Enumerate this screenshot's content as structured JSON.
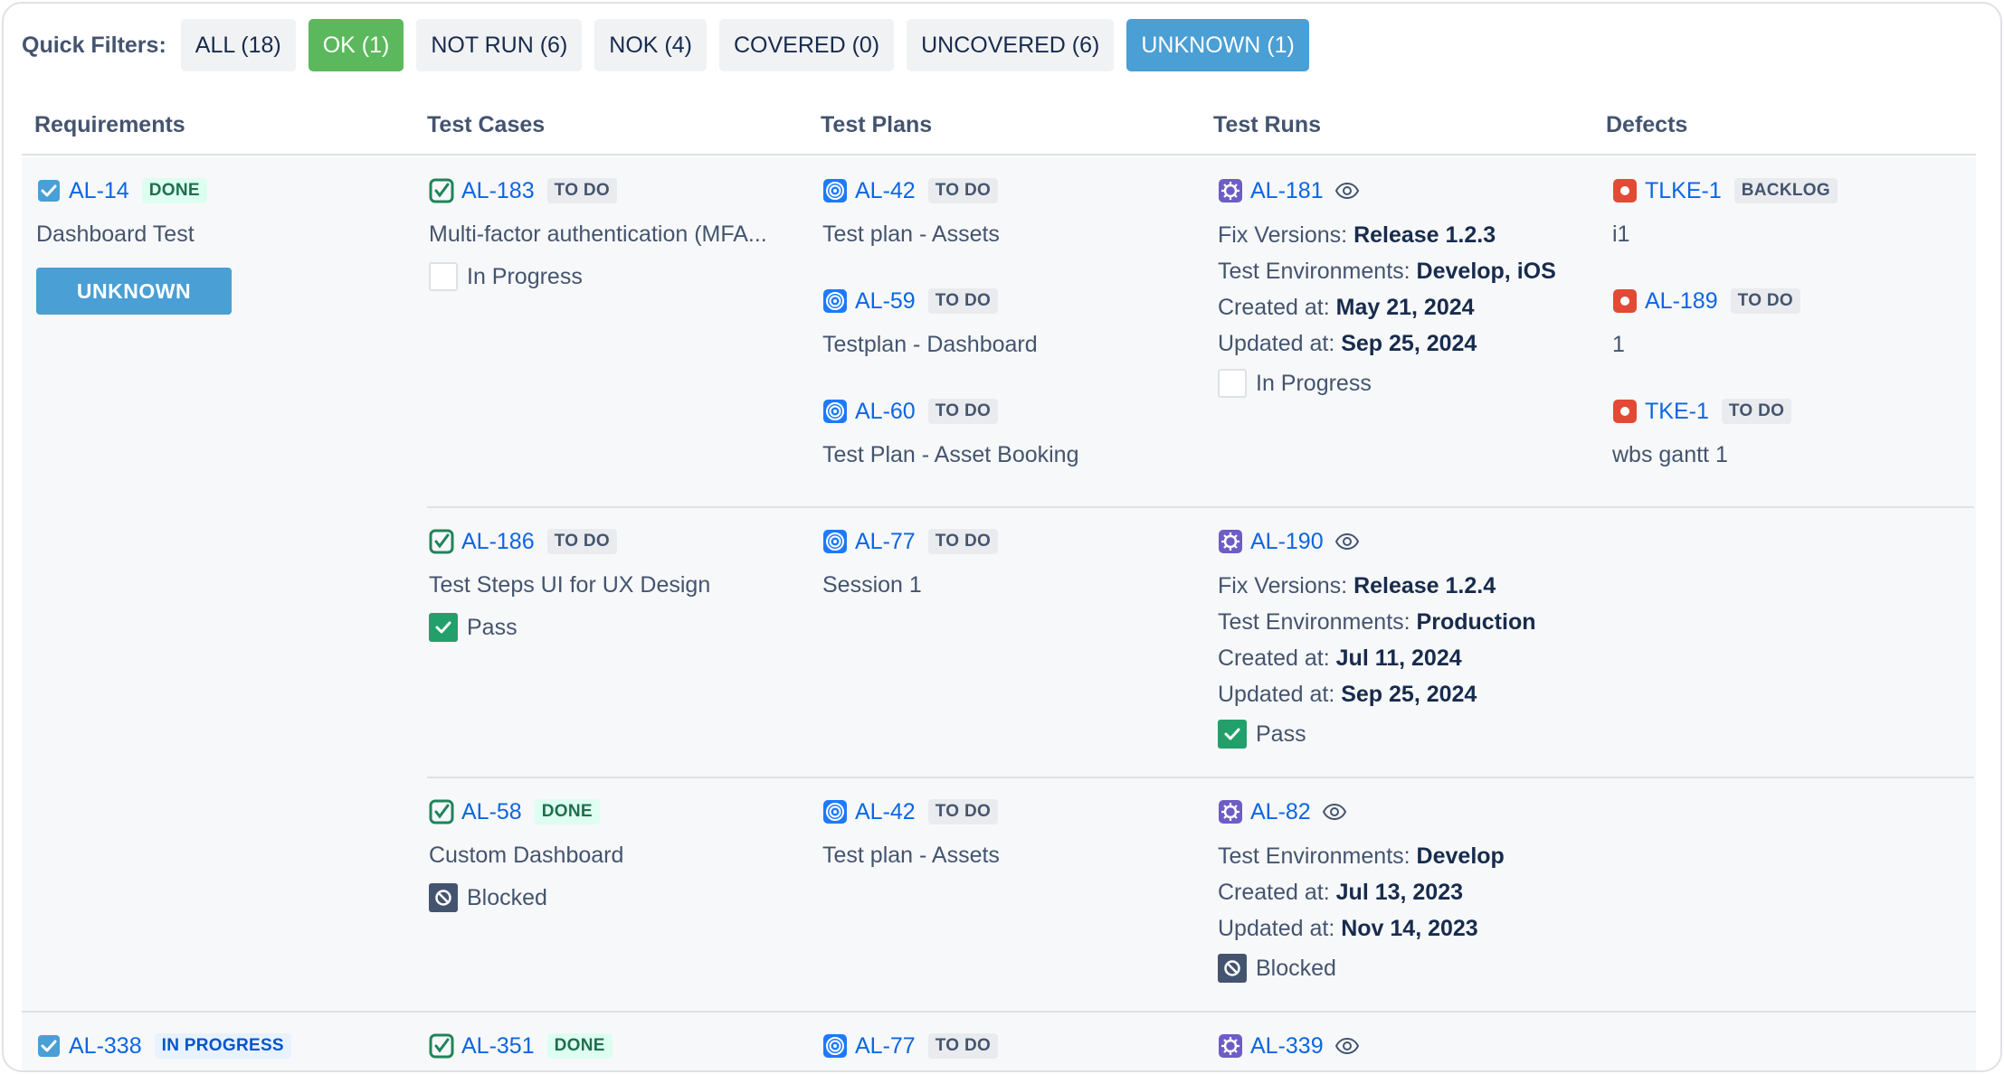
{
  "quick_filters": {
    "label": "Quick Filters:",
    "buttons": [
      {
        "label": "ALL (18)"
      },
      {
        "label": "OK (1)"
      },
      {
        "label": "NOT RUN (6)"
      },
      {
        "label": "NOK (4)"
      },
      {
        "label": "COVERED (0)"
      },
      {
        "label": "UNCOVERED (6)"
      },
      {
        "label": "UNKNOWN (1)"
      }
    ]
  },
  "columns": [
    "Requirements",
    "Test Cases",
    "Test Plans",
    "Test Runs",
    "Defects"
  ],
  "labels": {
    "fix_versions": "Fix Versions:",
    "test_environments": "Test Environments:",
    "created_at": "Created at:",
    "updated_at": "Updated at:"
  },
  "requirements": [
    {
      "key": "AL-14",
      "status": "DONE",
      "summary": "Dashboard Test",
      "coverage": "UNKNOWN"
    },
    {
      "key": "AL-338",
      "status": "IN PROGRESS"
    }
  ],
  "test_cases": [
    {
      "key": "AL-183",
      "status": "TO DO",
      "summary": "Multi-factor authentication (MFA...",
      "exec": "In Progress"
    },
    {
      "key": "AL-186",
      "status": "TO DO",
      "summary": "Test Steps UI for UX Design",
      "exec": "Pass"
    },
    {
      "key": "AL-58",
      "status": "DONE",
      "summary": "Custom Dashboard",
      "exec": "Blocked"
    },
    {
      "key": "AL-351",
      "status": "DONE"
    }
  ],
  "test_plans": [
    {
      "key": "AL-42",
      "status": "TO DO",
      "summary": "Test plan - Assets"
    },
    {
      "key": "AL-59",
      "status": "TO DO",
      "summary": "Testplan - Dashboard"
    },
    {
      "key": "AL-60",
      "status": "TO DO",
      "summary": "Test Plan - Asset Booking"
    },
    {
      "key": "AL-77",
      "status": "TO DO",
      "summary": "Session 1"
    },
    {
      "key": "AL-42",
      "status": "TO DO",
      "summary": "Test plan - Assets"
    },
    {
      "key": "AL-77",
      "status": "TO DO"
    }
  ],
  "test_runs": [
    {
      "key": "AL-181",
      "fix_versions": "Release 1.2.3",
      "environments": "Develop, iOS",
      "created": "May 21, 2024",
      "updated": "Sep 25, 2024",
      "exec": "In Progress"
    },
    {
      "key": "AL-190",
      "fix_versions": "Release 1.2.4",
      "environments": "Production",
      "created": "Jul 11, 2024",
      "updated": "Sep 25, 2024",
      "exec": "Pass"
    },
    {
      "key": "AL-82",
      "environments": "Develop",
      "created": "Jul 13, 2023",
      "updated": "Nov 14, 2023",
      "exec": "Blocked"
    },
    {
      "key": "AL-339"
    }
  ],
  "defects": [
    {
      "key": "TLKE-1",
      "status": "BACKLOG",
      "summary": "i1"
    },
    {
      "key": "AL-189",
      "status": "TO DO",
      "summary": "1"
    },
    {
      "key": "TKE-1",
      "status": "TO DO",
      "summary": "wbs gantt 1"
    }
  ],
  "colors": {
    "link": "#0c66e4",
    "ok_button": "#5cb85c",
    "unknown_button": "#4a9fd5",
    "pass": "#22a06b",
    "defect": "#e34935",
    "test_plan_icon": "#1d7afc",
    "test_run_icon": "#6e5dc6",
    "test_case_icon": "#1f845a"
  },
  "icons": {
    "requirement": "checkbox-story-icon",
    "test_case": "test-case-icon",
    "test_plan": "target-icon",
    "test_run": "gear-icon",
    "defect": "bug-icon",
    "watch": "eye-icon"
  }
}
